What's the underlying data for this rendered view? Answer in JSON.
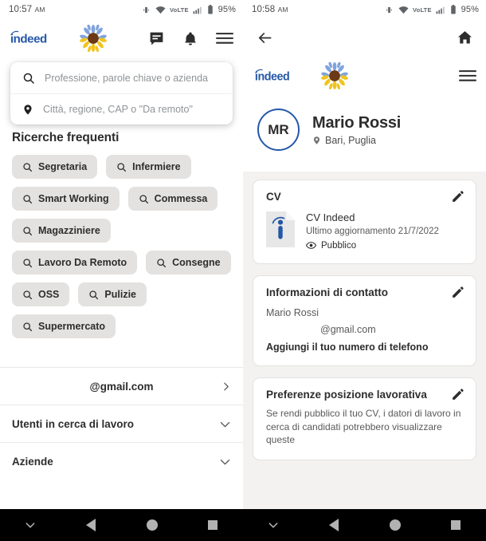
{
  "left": {
    "status": {
      "time": "10:57",
      "ampm": "AM",
      "network": "VoLTE",
      "battery": "95%"
    },
    "appbar": {
      "logo_text": "indeed",
      "sunflower": "sunflower-emoji",
      "messages_icon": "message-icon",
      "notifications_icon": "bell-icon",
      "menu_icon": "hamburger-menu-icon"
    },
    "search": {
      "what_placeholder": "Professione, parole chiave o azienda",
      "where_placeholder": "Città, regione, CAP o \"Da remoto\""
    },
    "frequent_title": "Ricerche frequenti",
    "chips": [
      "Segretaria",
      "Infermiere",
      "Smart Working",
      "Commessa",
      "Magazziniere",
      "Lavoro Da Remoto",
      "Consegne",
      "OSS",
      "Pulizie",
      "Supermercato"
    ],
    "rows": [
      {
        "label": "@gmail.com",
        "chevron": "chevron-right-icon"
      },
      {
        "label": "Utenti in cerca di lavoro",
        "chevron": "chevron-down-icon"
      },
      {
        "label": "Aziende",
        "chevron": "chevron-down-icon"
      }
    ]
  },
  "right": {
    "status": {
      "time": "10:58",
      "ampm": "AM",
      "network": "VoLTE",
      "battery": "95%"
    },
    "nav": {
      "back_icon": "arrow-left-icon",
      "home_icon": "home-icon"
    },
    "appbar": {
      "logo_text": "indeed",
      "sunflower": "sunflower-emoji",
      "menu_icon": "hamburger-menu-icon"
    },
    "profile": {
      "initials": "MR",
      "name": "Mario Rossi",
      "location": "Bari, Puglia",
      "location_icon": "location-pin-icon"
    },
    "cards": [
      {
        "title": "CV",
        "edit_icon": "pencil-icon",
        "file_icon": "document-indeed-icon",
        "file_name": "CV Indeed",
        "updated": "Ultimo aggiornamento 21/7/2022",
        "visibility": "Pubblico",
        "visibility_icon": "eye-icon"
      },
      {
        "title": "Informazioni di contatto",
        "edit_icon": "pencil-icon",
        "name": "Mario Rossi",
        "email": "@gmail.com",
        "add_phone": "Aggiungi il tuo numero di telefono"
      },
      {
        "title": "Preferenze posizione lavorativa",
        "edit_icon": "pencil-icon",
        "description": "Se rendi pubblico il tuo CV, i datori di lavoro in cerca di candidati potrebbero visualizzare queste"
      }
    ]
  },
  "androidnav": {
    "hide_keyboard_icon": "chevron-down-icon",
    "back_icon": "triangle-back-icon",
    "home_icon": "circle-home-icon",
    "recents_icon": "square-recents-icon"
  },
  "colors": {
    "indeed_blue": "#2557a7",
    "chip_bg": "#e4e2e0",
    "panel_bg": "#f3f2f1"
  }
}
